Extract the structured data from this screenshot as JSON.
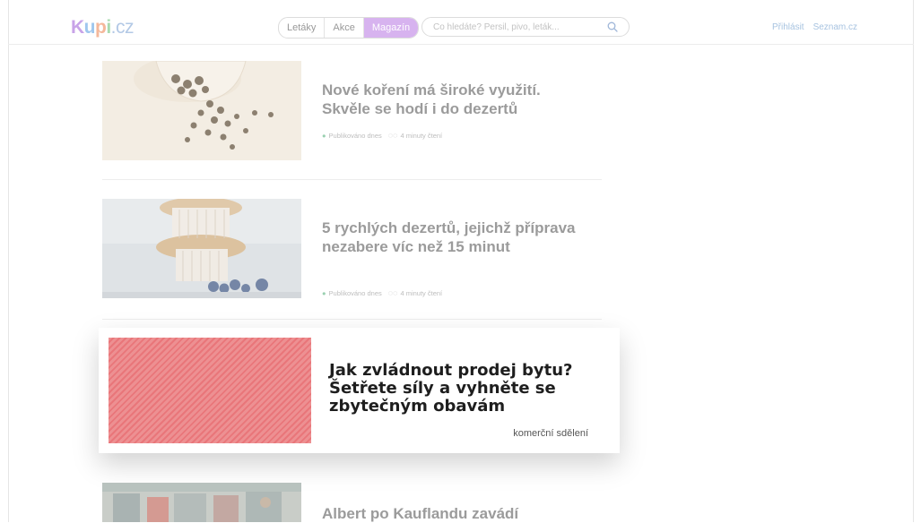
{
  "header": {
    "logo": {
      "k": "K",
      "u": "u",
      "p": "p",
      "i": "i",
      "cz": ".cz"
    },
    "tabs": [
      {
        "label": "Letáky"
      },
      {
        "label": "Akce"
      },
      {
        "label": "Magazín"
      }
    ],
    "active_tab": "Magazín",
    "search_placeholder": "Co hledáte? Persil, pivo, leták...",
    "links": [
      "Přihlásit",
      "Seznam.cz"
    ]
  },
  "articles": [
    {
      "title": "Nové koření má široké využití. Skvěle se hodí i do dezertů",
      "published": "Publikováno dnes",
      "read_time": "4 minuty čtení"
    },
    {
      "title": "5 rychlých dezertů, jejichž příprava nezabere víc než 15 minut",
      "published": "Publikováno dnes",
      "read_time": "4 minuty čtení"
    },
    {
      "title": "Albert po Kauflandu zavádí"
    }
  ],
  "promo": {
    "title": "Jak zvládnout prodej bytu? Šetřete síly a vyhněte se zbytečným obavám",
    "label": "komerční sdělení"
  },
  "colors": {
    "active_tab": "#d7b3ef",
    "promo_stripes": "#ec8a8c",
    "link": "#a7c3e0"
  }
}
